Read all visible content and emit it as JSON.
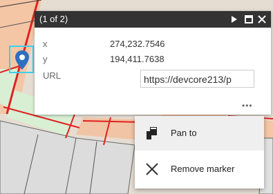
{
  "popup": {
    "title": "(1 of 2)",
    "fields": [
      {
        "key": "x",
        "value": "274,232.7546"
      },
      {
        "key": "y",
        "value": "194,411.7638"
      },
      {
        "key": "URL",
        "value": "https://devcore213/p"
      }
    ],
    "more_label": "•••"
  },
  "menu": {
    "items": [
      {
        "label": "Pan to",
        "icon": "pan-to-icon"
      },
      {
        "label": "Remove marker",
        "icon": "close-icon"
      }
    ]
  },
  "colors": {
    "header_bg": "#333333",
    "marker_blue": "#2f6fc0",
    "marker_outline": "#3fd0ee",
    "parcel_red": "#e02020",
    "map_fill": "#e6ddd3"
  }
}
